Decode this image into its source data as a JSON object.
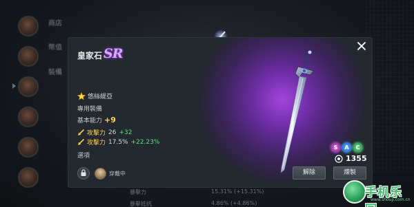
{
  "background": {
    "menu_items": [
      "商店",
      "幣值",
      "裝備"
    ],
    "bottom_stats": [
      {
        "label": "暴擊力",
        "value": "15.31% (+15.31%)"
      },
      {
        "label": "暴擊抵抗",
        "value": "4.86% (+4.86%)"
      }
    ]
  },
  "item": {
    "name": "皇家石",
    "grade": "SR",
    "hero": "悠絲緹亞",
    "exclusive_label": "專用裝備",
    "base_label": "基本能力",
    "base_value": "+9",
    "stats": [
      {
        "label": "攻擊力",
        "value": "26",
        "bonus": "+32"
      },
      {
        "label": "攻擊力",
        "value": "17.5%",
        "bonus": "+22.23%"
      }
    ],
    "option_label": "選項",
    "equipped_text": "穿戴中",
    "runes": [
      "S",
      "A",
      "C"
    ],
    "power": "1355",
    "buttons": {
      "dismantle": "解除",
      "refine": "煉製"
    }
  },
  "watermark": {
    "text": "手机乐园",
    "url": "www.shouji.com.cn"
  },
  "colors": {
    "panel_bg": "#24292f",
    "glow": "#a046e6",
    "stat_bonus": "#5ee07a",
    "highlight": "#ffcf4a",
    "grade": "#d9a8ff"
  },
  "icons": [
    "star-icon",
    "attack-icon",
    "close-icon",
    "lock-icon",
    "power-icon",
    "sword-icon"
  ]
}
